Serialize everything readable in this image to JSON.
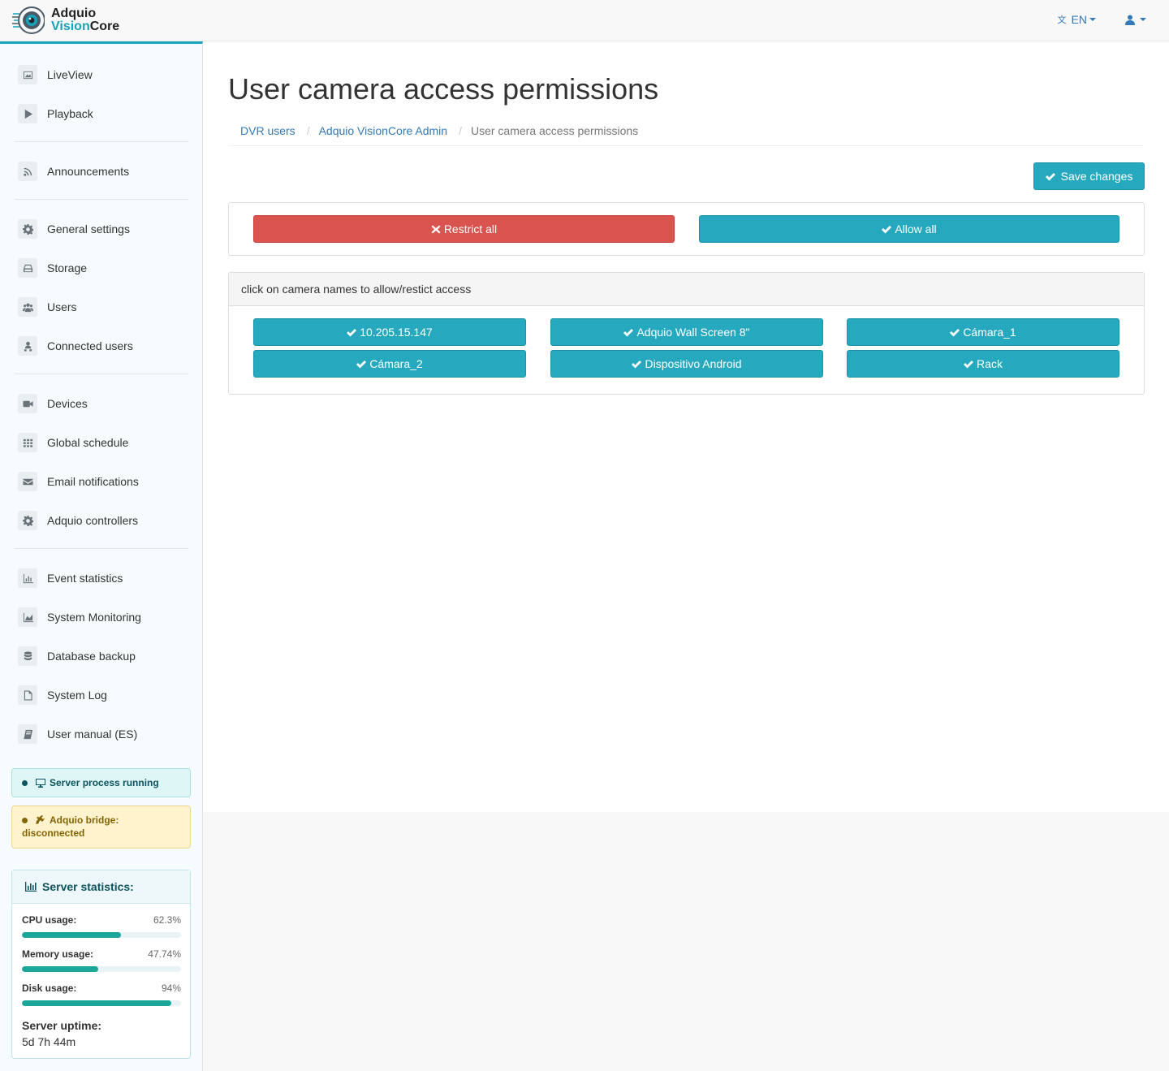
{
  "brand": {
    "line1": "Adquio",
    "line2a": "Vision",
    "line2b": "Core"
  },
  "header": {
    "language": "EN"
  },
  "sidebar": {
    "items": [
      {
        "label": "LiveView",
        "icon": "image-icon"
      },
      {
        "label": "Playback",
        "icon": "play-icon"
      },
      {
        "label": "Announcements",
        "icon": "rss-icon"
      },
      {
        "label": "General settings",
        "icon": "gear-icon"
      },
      {
        "label": "Storage",
        "icon": "hdd-icon"
      },
      {
        "label": "Users",
        "icon": "users-icon"
      },
      {
        "label": "Connected users",
        "icon": "user-network-icon"
      },
      {
        "label": "Devices",
        "icon": "video-camera-icon"
      },
      {
        "label": "Global schedule",
        "icon": "grid-icon"
      },
      {
        "label": "Email notifications",
        "icon": "envelope-icon"
      },
      {
        "label": "Adquio controllers",
        "icon": "gear-icon"
      },
      {
        "label": "Event statistics",
        "icon": "bar-chart-icon"
      },
      {
        "label": "System Monitoring",
        "icon": "area-chart-icon"
      },
      {
        "label": "Database backup",
        "icon": "database-icon"
      },
      {
        "label": "System Log",
        "icon": "file-icon"
      },
      {
        "label": "User manual (ES)",
        "icon": "book-icon"
      }
    ]
  },
  "status": {
    "server": "Server process running",
    "bridge": "Adquio bridge: disconnected"
  },
  "stats": {
    "title": "Server statistics:",
    "cpu": {
      "label": "CPU usage:",
      "value": "62.3%",
      "percent": 62.3
    },
    "memory": {
      "label": "Memory usage:",
      "value": "47.74%",
      "percent": 47.74
    },
    "disk": {
      "label": "Disk usage:",
      "value": "94%",
      "percent": 94
    },
    "uptime_label": "Server uptime:",
    "uptime_value": "5d 7h 44m"
  },
  "main": {
    "title": "User camera access permissions",
    "breadcrumb": [
      "DVR users",
      "Adquio VisionCore Admin",
      "User camera access permissions"
    ],
    "save_label": "Save changes",
    "restrict_label": "Restrict all",
    "allow_label": "Allow all",
    "cameras_heading": "click on camera names to allow/restict access",
    "cameras": [
      "10.205.15.147",
      "Adquio Wall Screen 8\"",
      "Cámara_1",
      "Cámara_2",
      "Dispositivo Android",
      "Rack"
    ]
  },
  "colors": {
    "accent": "#26a9bf",
    "danger": "#d9534f",
    "progress": "#1aa79a"
  }
}
